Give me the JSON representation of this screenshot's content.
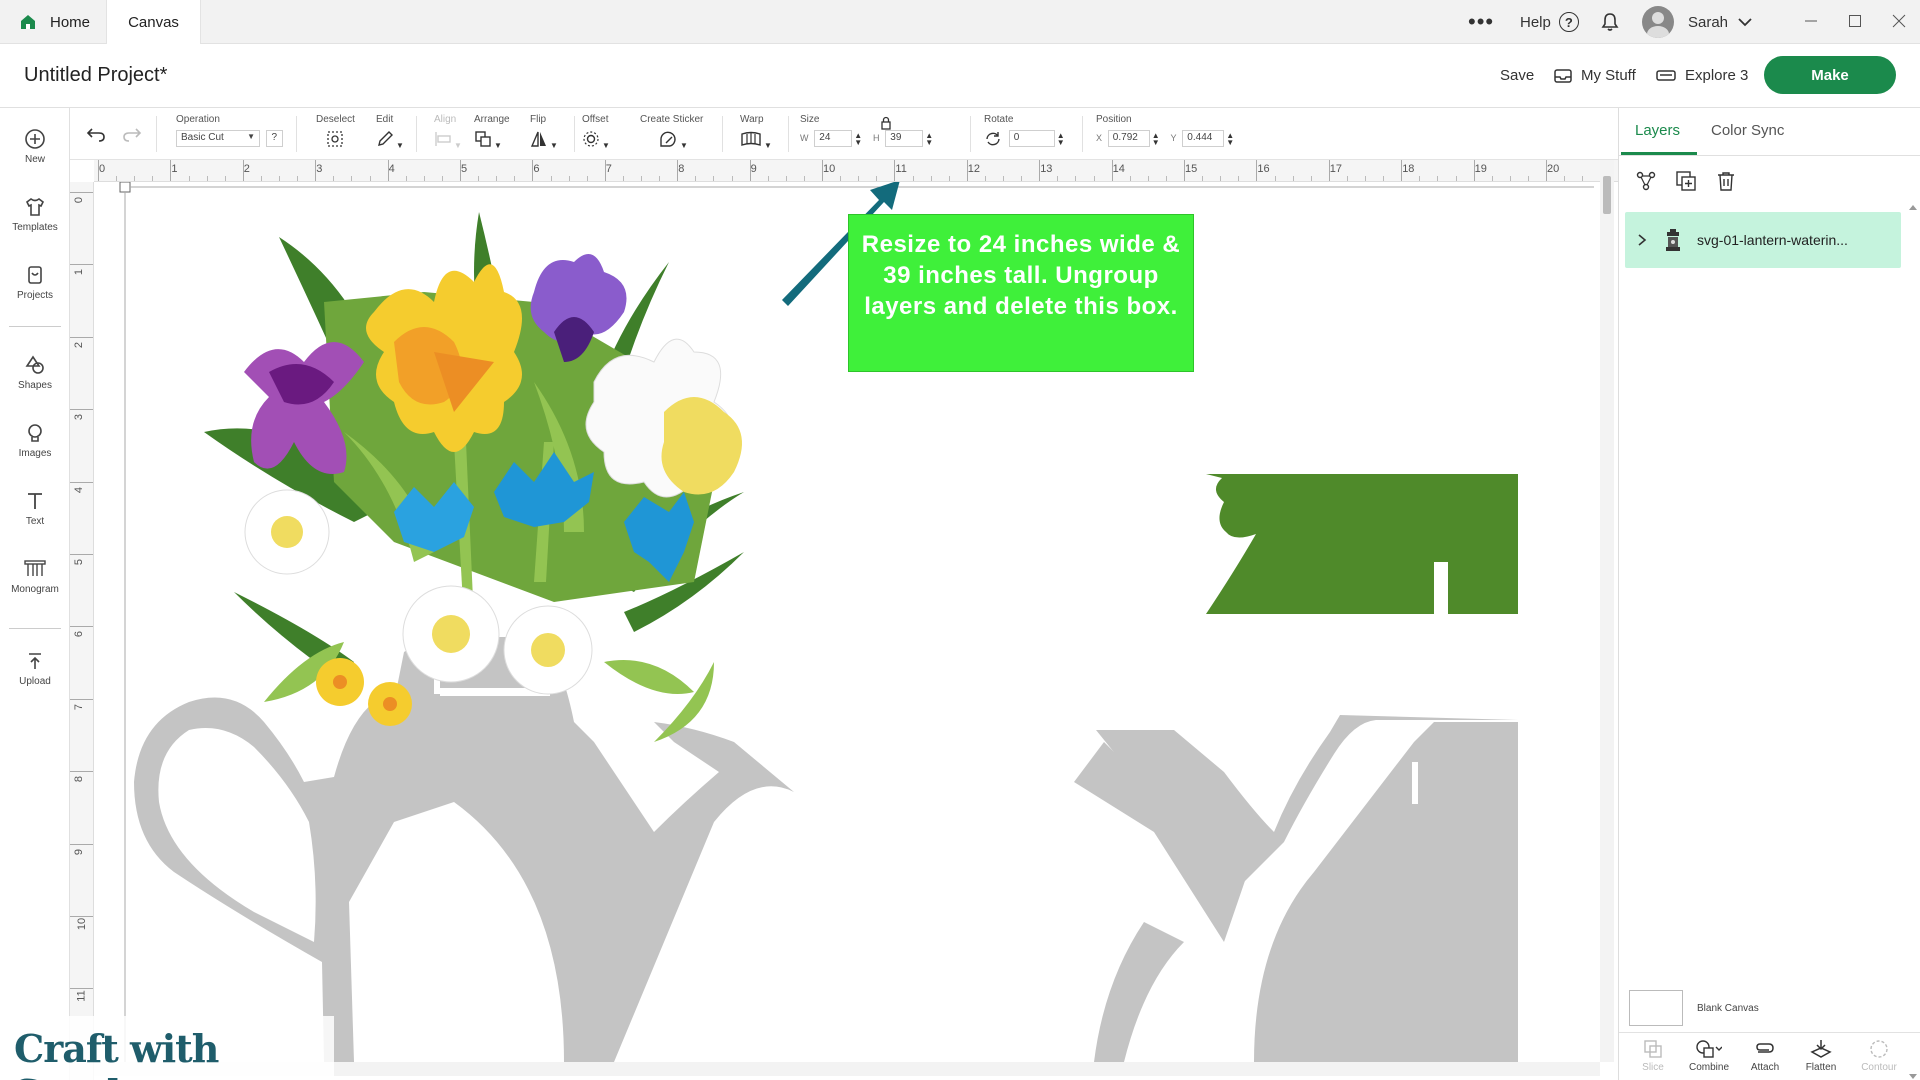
{
  "tabs": {
    "home": "Home",
    "canvas": "Canvas"
  },
  "topbar": {
    "more": "•••",
    "help": "Help",
    "help_glyph": "?",
    "user": "Sarah"
  },
  "project": {
    "title": "Untitled Project*",
    "save": "Save",
    "my_stuff": "My Stuff",
    "machine": "Explore 3",
    "make": "Make"
  },
  "sidebar": {
    "new": "New",
    "templates": "Templates",
    "projects": "Projects",
    "shapes": "Shapes",
    "images": "Images",
    "text": "Text",
    "monogram": "Monogram",
    "upload": "Upload"
  },
  "toolbar": {
    "operation_label": "Operation",
    "operation_value": "Basic Cut",
    "operation_help": "?",
    "deselect": "Deselect",
    "edit": "Edit",
    "align": "Align",
    "arrange": "Arrange",
    "flip": "Flip",
    "offset": "Offset",
    "create_sticker": "Create Sticker",
    "warp": "Warp",
    "size": "Size",
    "w_label": "W",
    "w_value": "24",
    "h_label": "H",
    "h_value": "39",
    "rotate": "Rotate",
    "rotate_value": "0",
    "position": "Position",
    "x_label": "X",
    "x_value": "0.792",
    "y_label": "Y",
    "y_value": "0.444"
  },
  "ruler": {
    "top": [
      "0",
      "1",
      "2",
      "3",
      "4",
      "5",
      "6",
      "7",
      "8",
      "9",
      "10",
      "11",
      "12",
      "13",
      "14",
      "15",
      "16",
      "17",
      "18",
      "19",
      "20"
    ],
    "left": [
      "0",
      "1",
      "2",
      "3",
      "4",
      "5",
      "6",
      "7",
      "8",
      "9",
      "10",
      "11"
    ]
  },
  "annotation": {
    "text": "Resize to 24 inches wide & 39 inches tall. Ungroup layers and delete this box."
  },
  "watermark": "Craft with Sarah",
  "panel": {
    "tab_layers": "Layers",
    "tab_color_sync": "Color Sync",
    "layer_name": "svg-01-lantern-waterin...",
    "blank_canvas": "Blank Canvas",
    "slice": "Slice",
    "combine": "Combine",
    "attach": "Attach",
    "flatten": "Flatten",
    "contour": "Contour"
  },
  "colors": {
    "accent": "#1b8a4c",
    "callout": "#3ff03a",
    "arrow": "#136b7c",
    "can_gray": "#c4c4c4",
    "leaf_green": "#4f8a2a"
  }
}
